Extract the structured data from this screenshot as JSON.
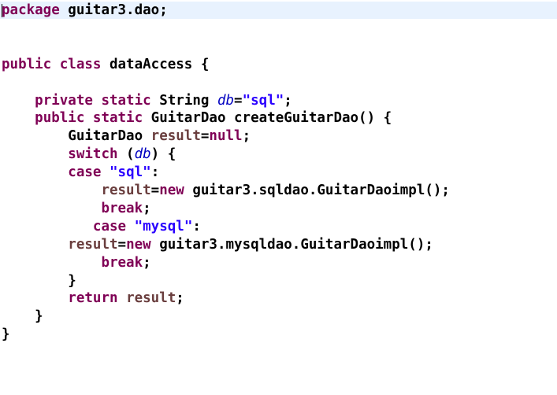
{
  "editor": {
    "language": "java",
    "colors": {
      "keyword": "#7f0055",
      "plain": "#000000",
      "string": "#2a00ff",
      "field": "#0000c0",
      "local": "#6a3e3e",
      "current_line": "#e8f2fe"
    },
    "current_line_index": 0,
    "lines": [
      {
        "tokens": [
          {
            "type": "keyword",
            "text": "package"
          },
          {
            "type": "plain",
            "text": " guitar3.dao;"
          }
        ]
      },
      {
        "tokens": []
      },
      {
        "tokens": []
      },
      {
        "tokens": [
          {
            "type": "keyword",
            "text": "public class"
          },
          {
            "type": "plain",
            "text": " dataAccess {"
          }
        ]
      },
      {
        "tokens": []
      },
      {
        "tokens": [
          {
            "type": "plain",
            "text": "    "
          },
          {
            "type": "keyword",
            "text": "private static"
          },
          {
            "type": "plain",
            "text": " String "
          },
          {
            "type": "field",
            "text": "db"
          },
          {
            "type": "plain",
            "text": "="
          },
          {
            "type": "string",
            "text": "\"sql\""
          },
          {
            "type": "plain",
            "text": ";"
          }
        ]
      },
      {
        "tokens": [
          {
            "type": "plain",
            "text": "    "
          },
          {
            "type": "keyword",
            "text": "public static"
          },
          {
            "type": "plain",
            "text": " GuitarDao createGuitarDao() {"
          }
        ]
      },
      {
        "tokens": [
          {
            "type": "plain",
            "text": "        GuitarDao "
          },
          {
            "type": "local",
            "text": "result"
          },
          {
            "type": "plain",
            "text": "="
          },
          {
            "type": "keyword",
            "text": "null"
          },
          {
            "type": "plain",
            "text": ";"
          }
        ]
      },
      {
        "tokens": [
          {
            "type": "plain",
            "text": "        "
          },
          {
            "type": "keyword",
            "text": "switch"
          },
          {
            "type": "plain",
            "text": " ("
          },
          {
            "type": "field",
            "text": "db"
          },
          {
            "type": "plain",
            "text": ") {"
          }
        ]
      },
      {
        "tokens": [
          {
            "type": "plain",
            "text": "        "
          },
          {
            "type": "keyword",
            "text": "case"
          },
          {
            "type": "plain",
            "text": " "
          },
          {
            "type": "string",
            "text": "\"sql\""
          },
          {
            "type": "plain",
            "text": ":"
          }
        ]
      },
      {
        "tokens": [
          {
            "type": "plain",
            "text": "            "
          },
          {
            "type": "local",
            "text": "result"
          },
          {
            "type": "plain",
            "text": "="
          },
          {
            "type": "keyword",
            "text": "new"
          },
          {
            "type": "plain",
            "text": " guitar3.sqldao.GuitarDaoimpl();"
          }
        ]
      },
      {
        "tokens": [
          {
            "type": "plain",
            "text": "            "
          },
          {
            "type": "keyword",
            "text": "break"
          },
          {
            "type": "plain",
            "text": ";"
          }
        ]
      },
      {
        "tokens": [
          {
            "type": "plain",
            "text": "           "
          },
          {
            "type": "keyword",
            "text": "case"
          },
          {
            "type": "plain",
            "text": " "
          },
          {
            "type": "string",
            "text": "\"mysql\""
          },
          {
            "type": "plain",
            "text": ":"
          }
        ]
      },
      {
        "tokens": [
          {
            "type": "plain",
            "text": "        "
          },
          {
            "type": "local",
            "text": "result"
          },
          {
            "type": "plain",
            "text": "="
          },
          {
            "type": "keyword",
            "text": "new"
          },
          {
            "type": "plain",
            "text": " guitar3.mysqldao.GuitarDaoimpl();"
          }
        ]
      },
      {
        "tokens": [
          {
            "type": "plain",
            "text": "            "
          },
          {
            "type": "keyword",
            "text": "break"
          },
          {
            "type": "plain",
            "text": ";"
          }
        ]
      },
      {
        "tokens": [
          {
            "type": "plain",
            "text": "        }"
          }
        ]
      },
      {
        "tokens": [
          {
            "type": "plain",
            "text": "        "
          },
          {
            "type": "keyword",
            "text": "return"
          },
          {
            "type": "plain",
            "text": " "
          },
          {
            "type": "local",
            "text": "result"
          },
          {
            "type": "plain",
            "text": ";"
          }
        ]
      },
      {
        "tokens": [
          {
            "type": "plain",
            "text": "    }"
          }
        ]
      },
      {
        "tokens": [
          {
            "type": "plain",
            "text": "}"
          }
        ]
      }
    ]
  }
}
